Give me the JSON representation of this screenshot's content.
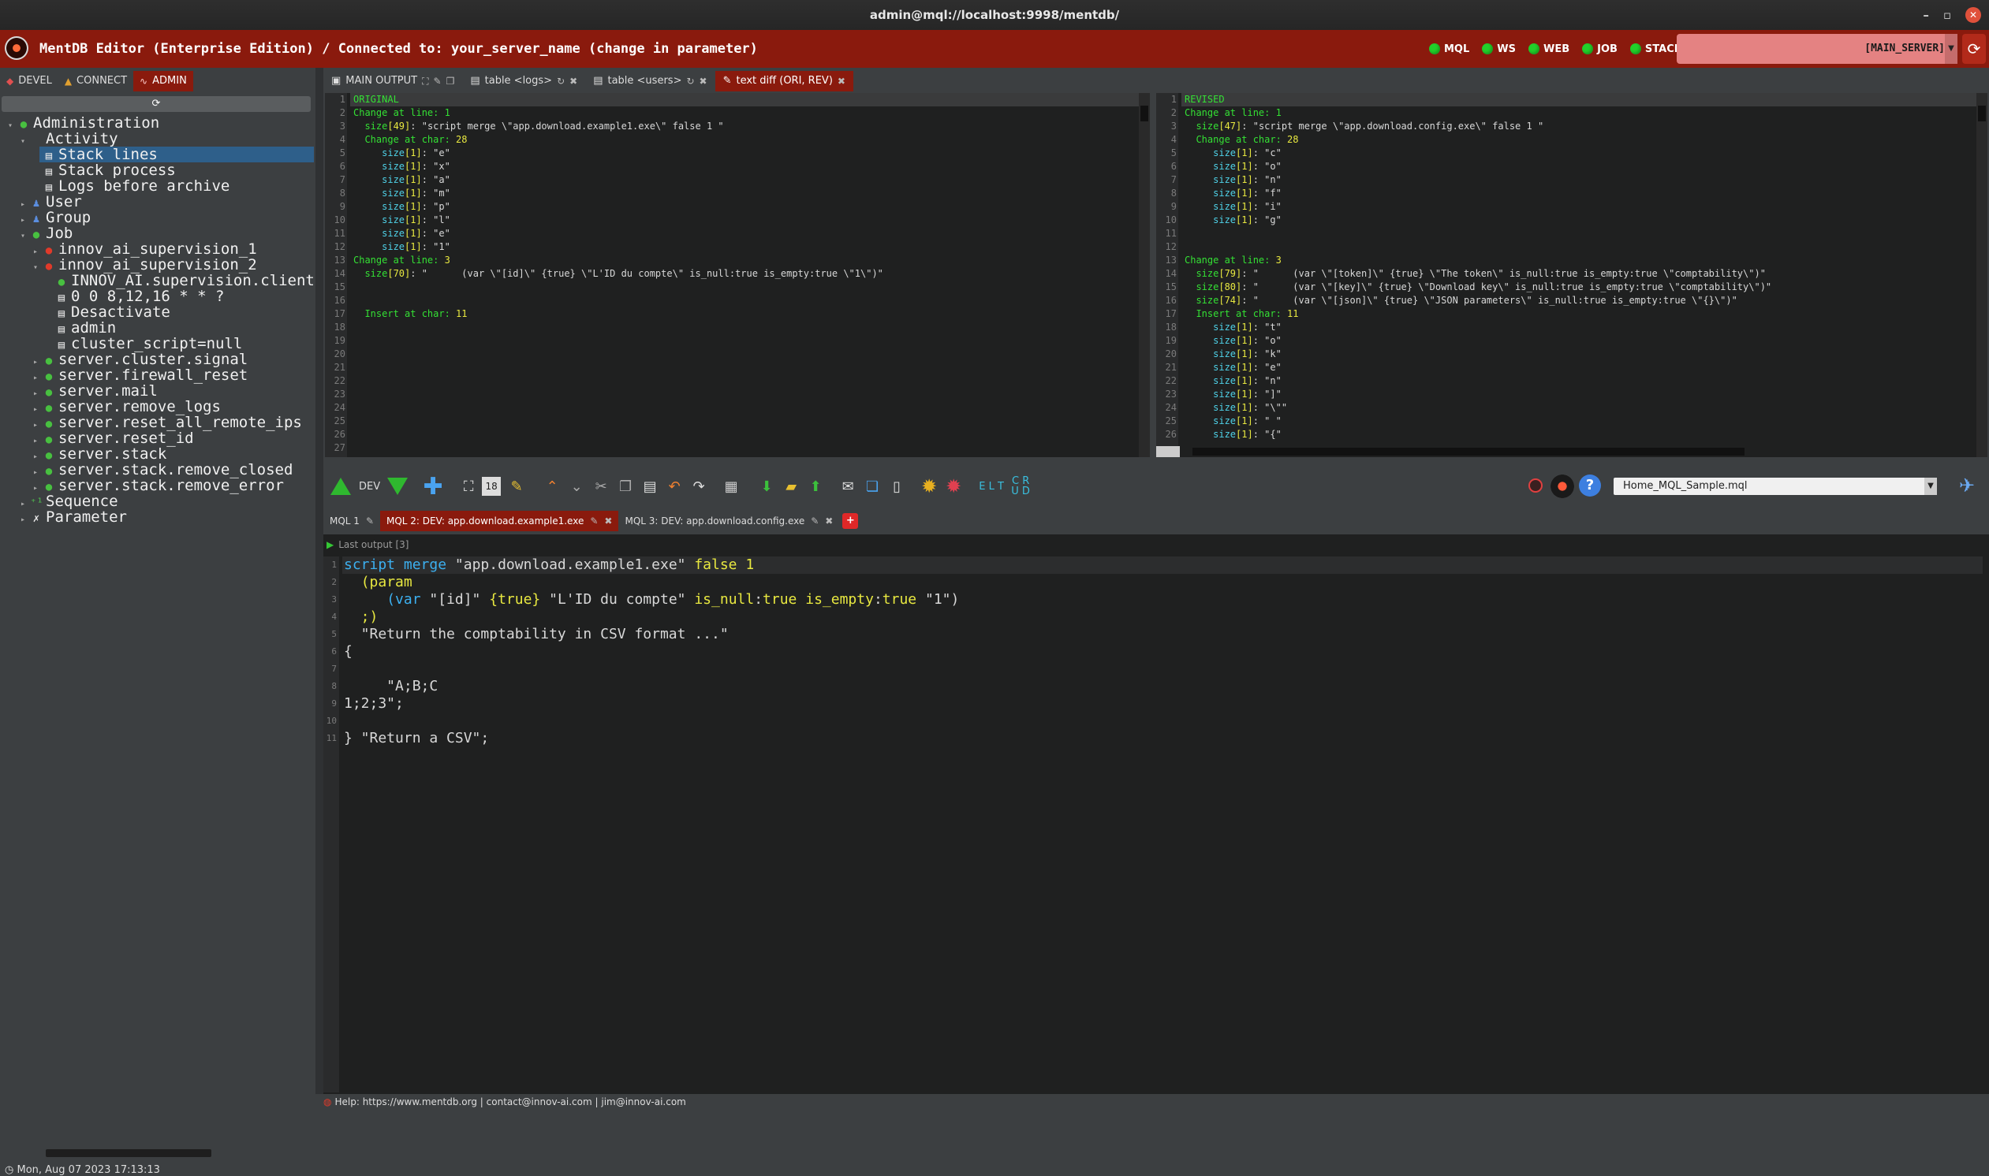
{
  "window": {
    "title": "admin@mql://localhost:9998/mentdb/"
  },
  "header": {
    "title": "MentDB Editor (Enterprise Edition) / Connected to: your_server_name (change in parameter)",
    "status": [
      {
        "label": "MQL",
        "color": "#22d02a"
      },
      {
        "label": "WS",
        "color": "#22d02a"
      },
      {
        "label": "WEB",
        "color": "#22d02a"
      },
      {
        "label": "JOB",
        "color": "#22d02a"
      },
      {
        "label": "STACK",
        "color": "#22d02a"
      }
    ],
    "server": "[MAIN_SERVER]"
  },
  "left": {
    "tabs": [
      "DEVEL",
      "CONNECT",
      "ADMIN"
    ],
    "active_tab": "ADMIN",
    "tree": [
      {
        "label": "Administration",
        "level": 0,
        "icon": "green",
        "arrow": "▾"
      },
      {
        "label": "Activity",
        "level": 1,
        "icon": "none",
        "arrow": "▾"
      },
      {
        "label": "Stack lines",
        "level": 2,
        "icon": "doc",
        "arrow": "",
        "selected": true
      },
      {
        "label": "Stack process",
        "level": 2,
        "icon": "doc",
        "arrow": ""
      },
      {
        "label": "Logs before archive",
        "level": 2,
        "icon": "doc",
        "arrow": ""
      },
      {
        "label": "User",
        "level": 1,
        "icon": "user",
        "arrow": "▸"
      },
      {
        "label": "Group",
        "level": 1,
        "icon": "user",
        "arrow": "▸"
      },
      {
        "label": "Job",
        "level": 1,
        "icon": "green",
        "arrow": "▾"
      },
      {
        "label": "innov_ai_supervision_1",
        "level": 2,
        "icon": "red",
        "arrow": "▸"
      },
      {
        "label": "innov_ai_supervision_2",
        "level": 2,
        "icon": "red",
        "arrow": "▾"
      },
      {
        "label": "INNOV_AI.supervision.client.",
        "level": 3,
        "icon": "green",
        "arrow": ""
      },
      {
        "label": "0 0 8,12,16 * * ?",
        "level": 3,
        "icon": "doc",
        "arrow": ""
      },
      {
        "label": "Desactivate",
        "level": 3,
        "icon": "doc",
        "arrow": ""
      },
      {
        "label": "admin",
        "level": 3,
        "icon": "doc",
        "arrow": ""
      },
      {
        "label": "cluster_script=null",
        "level": 3,
        "icon": "doc",
        "arrow": ""
      },
      {
        "label": "server.cluster.signal",
        "level": 2,
        "icon": "green",
        "arrow": "▸"
      },
      {
        "label": "server.firewall_reset",
        "level": 2,
        "icon": "green",
        "arrow": "▸"
      },
      {
        "label": "server.mail",
        "level": 2,
        "icon": "green",
        "arrow": "▸"
      },
      {
        "label": "server.remove_logs",
        "level": 2,
        "icon": "green",
        "arrow": "▸"
      },
      {
        "label": "server.reset_all_remote_ips",
        "level": 2,
        "icon": "green",
        "arrow": "▸"
      },
      {
        "label": "server.reset_id",
        "level": 2,
        "icon": "green",
        "arrow": "▸"
      },
      {
        "label": "server.stack",
        "level": 2,
        "icon": "green",
        "arrow": "▸"
      },
      {
        "label": "server.stack.remove_closed",
        "level": 2,
        "icon": "green",
        "arrow": "▸"
      },
      {
        "label": "server.stack.remove_error",
        "level": 2,
        "icon": "green",
        "arrow": "▸"
      },
      {
        "label": "Sequence",
        "level": 1,
        "icon": "seq",
        "arrow": "▸"
      },
      {
        "label": "Parameter",
        "level": 1,
        "icon": "param",
        "arrow": "▸"
      }
    ],
    "datetime": "Mon, Aug 07 2023 17:13:13"
  },
  "top_tabs": [
    {
      "label": "MAIN OUTPUT",
      "active": false
    },
    {
      "label": "table <logs>",
      "active": false
    },
    {
      "label": "table <users>",
      "active": false
    },
    {
      "label": "text diff (ORI, REV)",
      "active": true
    }
  ],
  "diff_left": {
    "lines": [
      [
        [
          "g",
          "ORIGINAL"
        ]
      ],
      [
        [
          "g",
          "Change at line: 1"
        ]
      ],
      [
        [
          "g",
          "  size"
        ],
        [
          "y",
          "[49]"
        ],
        [
          "w",
          ": \"script merge \\\"app.download.example1.exe\\\" false 1 \""
        ]
      ],
      [
        [
          "g",
          "  Change at char: "
        ],
        [
          "y",
          "28"
        ]
      ],
      [
        [
          "c",
          "     size"
        ],
        [
          "y",
          "[1]"
        ],
        [
          "w",
          ": \"e\""
        ]
      ],
      [
        [
          "c",
          "     size"
        ],
        [
          "y",
          "[1]"
        ],
        [
          "w",
          ": \"x\""
        ]
      ],
      [
        [
          "c",
          "     size"
        ],
        [
          "y",
          "[1]"
        ],
        [
          "w",
          ": \"a\""
        ]
      ],
      [
        [
          "c",
          "     size"
        ],
        [
          "y",
          "[1]"
        ],
        [
          "w",
          ": \"m\""
        ]
      ],
      [
        [
          "c",
          "     size"
        ],
        [
          "y",
          "[1]"
        ],
        [
          "w",
          ": \"p\""
        ]
      ],
      [
        [
          "c",
          "     size"
        ],
        [
          "y",
          "[1]"
        ],
        [
          "w",
          ": \"l\""
        ]
      ],
      [
        [
          "c",
          "     size"
        ],
        [
          "y",
          "[1]"
        ],
        [
          "w",
          ": \"e\""
        ]
      ],
      [
        [
          "c",
          "     size"
        ],
        [
          "y",
          "[1]"
        ],
        [
          "w",
          ": \"1\""
        ]
      ],
      [
        [
          "g",
          "Change at line: "
        ],
        [
          "y",
          "3"
        ]
      ],
      [
        [
          "g",
          "  size"
        ],
        [
          "y",
          "[70]"
        ],
        [
          "w",
          ": \"      (var \\\"[id]\\\" {true} \\\"L'ID du compte\\\" is_null:true is_empty:true \\\"1\\\")\""
        ]
      ],
      [],
      [],
      [
        [
          "g",
          "  Insert at char: "
        ],
        [
          "y",
          "11"
        ]
      ],
      [],
      [],
      [],
      [],
      [],
      [],
      [],
      [],
      [],
      []
    ]
  },
  "diff_right": {
    "lines": [
      [
        [
          "g",
          "REVISED"
        ]
      ],
      [
        [
          "g",
          "Change at line: 1"
        ]
      ],
      [
        [
          "g",
          "  size"
        ],
        [
          "y",
          "[47]"
        ],
        [
          "w",
          ": \"script merge \\\"app.download.config.exe\\\" false 1 \""
        ]
      ],
      [
        [
          "g",
          "  Change at char: "
        ],
        [
          "y",
          "28"
        ]
      ],
      [
        [
          "c",
          "     size"
        ],
        [
          "y",
          "[1]"
        ],
        [
          "w",
          ": \"c\""
        ]
      ],
      [
        [
          "c",
          "     size"
        ],
        [
          "y",
          "[1]"
        ],
        [
          "w",
          ": \"o\""
        ]
      ],
      [
        [
          "c",
          "     size"
        ],
        [
          "y",
          "[1]"
        ],
        [
          "w",
          ": \"n\""
        ]
      ],
      [
        [
          "c",
          "     size"
        ],
        [
          "y",
          "[1]"
        ],
        [
          "w",
          ": \"f\""
        ]
      ],
      [
        [
          "c",
          "     size"
        ],
        [
          "y",
          "[1]"
        ],
        [
          "w",
          ": \"i\""
        ]
      ],
      [
        [
          "c",
          "     size"
        ],
        [
          "y",
          "[1]"
        ],
        [
          "w",
          ": \"g\""
        ]
      ],
      [],
      [],
      [
        [
          "g",
          "Change at line: "
        ],
        [
          "y",
          "3"
        ]
      ],
      [
        [
          "g",
          "  size"
        ],
        [
          "y",
          "[79]"
        ],
        [
          "w",
          ": \"      (var \\\"[token]\\\" {true} \\\"The token\\\" is_null:true is_empty:true \\\"comptability\\\")\""
        ]
      ],
      [
        [
          "g",
          "  size"
        ],
        [
          "y",
          "[80]"
        ],
        [
          "w",
          ": \"      (var \\\"[key]\\\" {true} \\\"Download key\\\" is_null:true is_empty:true \\\"comptability\\\")\""
        ]
      ],
      [
        [
          "g",
          "  size"
        ],
        [
          "y",
          "[74]"
        ],
        [
          "w",
          ": \"      (var \\\"[json]\\\" {true} \\\"JSON parameters\\\" is_null:true is_empty:true \\\"{}\\\")\""
        ]
      ],
      [
        [
          "g",
          "  Insert at char: "
        ],
        [
          "y",
          "11"
        ]
      ],
      [
        [
          "c",
          "     size"
        ],
        [
          "y",
          "[1]"
        ],
        [
          "w",
          ": \"t\""
        ]
      ],
      [
        [
          "c",
          "     size"
        ],
        [
          "y",
          "[1]"
        ],
        [
          "w",
          ": \"o\""
        ]
      ],
      [
        [
          "c",
          "     size"
        ],
        [
          "y",
          "[1]"
        ],
        [
          "w",
          ": \"k\""
        ]
      ],
      [
        [
          "c",
          "     size"
        ],
        [
          "y",
          "[1]"
        ],
        [
          "w",
          ": \"e\""
        ]
      ],
      [
        [
          "c",
          "     size"
        ],
        [
          "y",
          "[1]"
        ],
        [
          "w",
          ": \"n\""
        ]
      ],
      [
        [
          "c",
          "     size"
        ],
        [
          "y",
          "[1]"
        ],
        [
          "w",
          ": \"]\""
        ]
      ],
      [
        [
          "c",
          "     size"
        ],
        [
          "y",
          "[1]"
        ],
        [
          "w",
          ": \"\\\"\""
        ]
      ],
      [
        [
          "c",
          "     size"
        ],
        [
          "y",
          "[1]"
        ],
        [
          "w",
          ": \" \""
        ]
      ],
      [
        [
          "c",
          "     size"
        ],
        [
          "y",
          "[1]"
        ],
        [
          "w",
          ": \"{\""
        ]
      ]
    ]
  },
  "toolbar": {
    "env": "DEV",
    "zoom": "18",
    "elt_label": "E L T",
    "crud_label": "C R U D",
    "file": "Home_MQL_Sample.mql"
  },
  "editor_tabs": [
    {
      "label": "MQL 1",
      "active": false
    },
    {
      "label": "MQL 2: DEV: app.download.example1.exe",
      "active": true
    },
    {
      "label": "MQL 3: DEV: app.download.config.exe",
      "active": false
    }
  ],
  "editor": {
    "last_output": "Last output [3]",
    "lines": [
      [
        [
          "kw",
          "script merge "
        ],
        [
          "w",
          "\"app.download.example1.exe\" "
        ],
        [
          "yy",
          "false 1"
        ]
      ],
      [
        [
          "w",
          "  "
        ],
        [
          "yy",
          "(param"
        ]
      ],
      [
        [
          "w",
          "     "
        ],
        [
          "kw",
          "(var "
        ],
        [
          "w",
          "\"[id]\" "
        ],
        [
          "yy",
          "{true}"
        ],
        [
          "w",
          " \"L'ID du compte\" "
        ],
        [
          "yy",
          "is_null"
        ],
        [
          "w",
          ":"
        ],
        [
          "yy",
          "true is_empty"
        ],
        [
          "w",
          ":"
        ],
        [
          "yy",
          "true"
        ],
        [
          "w",
          " \"1\")"
        ]
      ],
      [
        [
          "yy",
          "  ;)"
        ]
      ],
      [
        [
          "w",
          "  \"Return the comptability in CSV format ...\""
        ]
      ],
      [
        [
          "w",
          "{"
        ]
      ],
      [],
      [
        [
          "w",
          "     \"A;B;C"
        ]
      ],
      [
        [
          "w",
          "1;2;3\";"
        ]
      ],
      [],
      [
        [
          "w",
          "} \"Return a CSV\";"
        ]
      ]
    ]
  },
  "help": "Help: https://www.mentdb.org | contact@innov-ai.com | jim@innov-ai.com"
}
